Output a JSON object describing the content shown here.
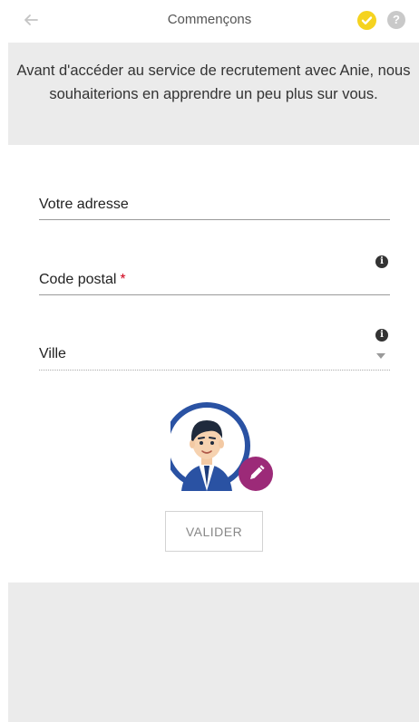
{
  "header": {
    "title": "Commençons",
    "back_icon": "arrow-left-icon",
    "check_icon": "check-circle-icon",
    "help_label": "?",
    "help_icon": "question-circle-icon",
    "accent_color": "#f5d320"
  },
  "intro": {
    "text": "Avant d'accéder au service de recrutement avec Anie, nous souhaiterions en apprendre un peu plus sur vous."
  },
  "form": {
    "address": {
      "label": "Votre adresse",
      "value": ""
    },
    "postal_code": {
      "label": "Code postal",
      "required_mark": "*",
      "value": ""
    },
    "city": {
      "label": "Ville",
      "value": ""
    },
    "info_glyph": "i"
  },
  "avatar": {
    "ring_color": "#2a52a3",
    "edit_color": "#9c2a78",
    "edit_icon": "pencil-icon"
  },
  "actions": {
    "submit_label": "VALIDER"
  }
}
